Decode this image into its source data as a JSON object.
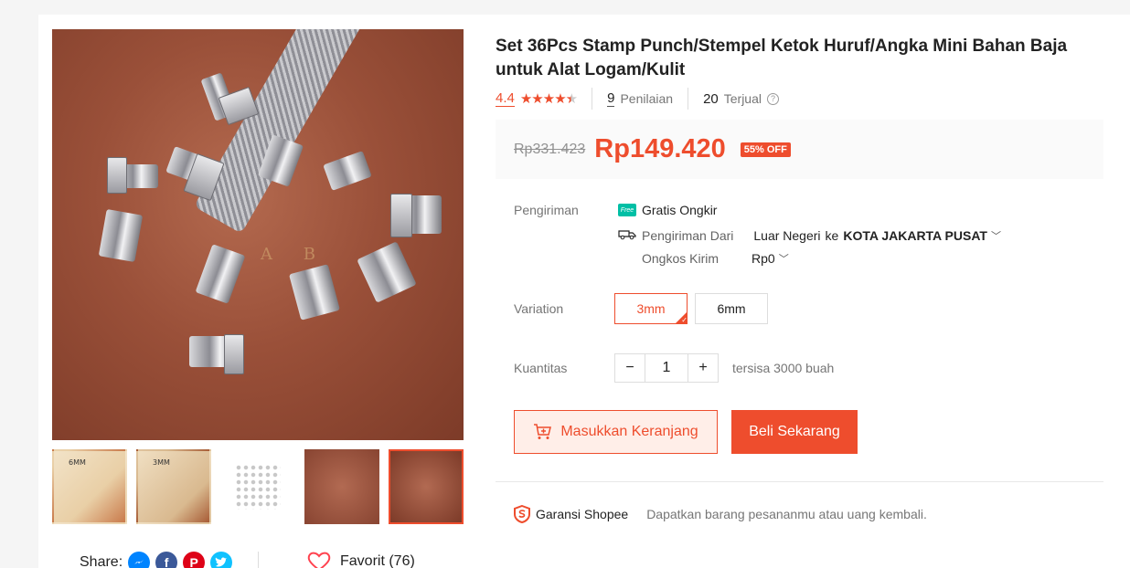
{
  "product": {
    "title": "Set 36Pcs Stamp Punch/Stempel Ketok Huruf/Angka Mini Bahan Baja untuk Alat Logam/Kulit",
    "rating": "4.4",
    "stars": 4.4,
    "reviews_count": "9",
    "reviews_label": "Penilaian",
    "sold_count": "20",
    "sold_label": "Terjual"
  },
  "price": {
    "original": "Rp331.423",
    "current": "Rp149.420",
    "discount": "55% OFF"
  },
  "shipping": {
    "label": "Pengiriman",
    "free_badge": "Free",
    "free_text": "Gratis Ongkir",
    "from_label": "Pengiriman Dari",
    "from_value": "Luar Negeri",
    "to_word": "ke",
    "to_value": "KOTA JAKARTA PUSAT",
    "cost_label": "Ongkos Kirim",
    "cost_value": "Rp0"
  },
  "variation": {
    "label": "Variation",
    "options": [
      "3mm",
      "6mm"
    ],
    "selected": "3mm"
  },
  "quantity": {
    "label": "Kuantitas",
    "value": "1",
    "minus": "−",
    "plus": "+",
    "stock": "tersisa 3000 buah"
  },
  "actions": {
    "cart": "Masukkan Keranjang",
    "buy": "Beli Sekarang"
  },
  "guarantee": {
    "title": "Garansi Shopee",
    "text": "Dapatkan barang pesananmu atau uang kembali."
  },
  "gallery": {
    "thumb_labels": [
      "6MM",
      "3MM"
    ],
    "active_thumb": 4,
    "main_letters": "A B"
  },
  "social": {
    "share_label": "Share:",
    "favorite": "Favorit (76)",
    "icons": [
      "messenger-icon",
      "facebook-icon",
      "pinterest-icon",
      "twitter-icon"
    ]
  },
  "colors": {
    "accent": "#ee4d2d",
    "free_badge": "#00bfa5"
  }
}
